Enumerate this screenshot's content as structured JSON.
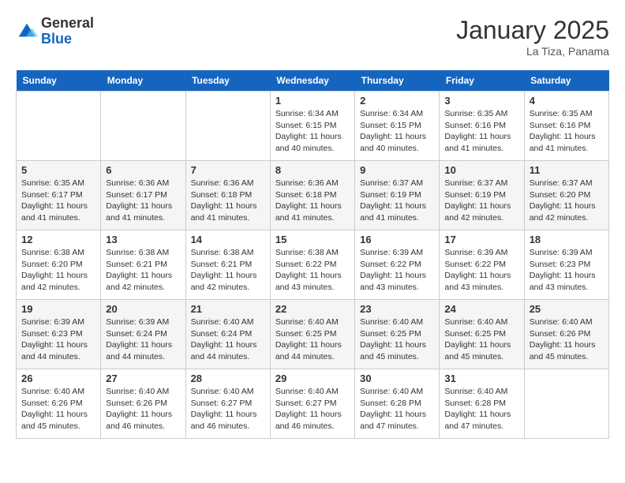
{
  "header": {
    "logo_general": "General",
    "logo_blue": "Blue",
    "month_year": "January 2025",
    "location": "La Tiza, Panama"
  },
  "days_of_week": [
    "Sunday",
    "Monday",
    "Tuesday",
    "Wednesday",
    "Thursday",
    "Friday",
    "Saturday"
  ],
  "weeks": [
    [
      {
        "num": "",
        "sunrise": "",
        "sunset": "",
        "daylight": "",
        "empty": true
      },
      {
        "num": "",
        "sunrise": "",
        "sunset": "",
        "daylight": "",
        "empty": true
      },
      {
        "num": "",
        "sunrise": "",
        "sunset": "",
        "daylight": "",
        "empty": true
      },
      {
        "num": "1",
        "sunrise": "Sunrise: 6:34 AM",
        "sunset": "Sunset: 6:15 PM",
        "daylight": "Daylight: 11 hours and 40 minutes."
      },
      {
        "num": "2",
        "sunrise": "Sunrise: 6:34 AM",
        "sunset": "Sunset: 6:15 PM",
        "daylight": "Daylight: 11 hours and 40 minutes."
      },
      {
        "num": "3",
        "sunrise": "Sunrise: 6:35 AM",
        "sunset": "Sunset: 6:16 PM",
        "daylight": "Daylight: 11 hours and 41 minutes."
      },
      {
        "num": "4",
        "sunrise": "Sunrise: 6:35 AM",
        "sunset": "Sunset: 6:16 PM",
        "daylight": "Daylight: 11 hours and 41 minutes."
      }
    ],
    [
      {
        "num": "5",
        "sunrise": "Sunrise: 6:35 AM",
        "sunset": "Sunset: 6:17 PM",
        "daylight": "Daylight: 11 hours and 41 minutes."
      },
      {
        "num": "6",
        "sunrise": "Sunrise: 6:36 AM",
        "sunset": "Sunset: 6:17 PM",
        "daylight": "Daylight: 11 hours and 41 minutes."
      },
      {
        "num": "7",
        "sunrise": "Sunrise: 6:36 AM",
        "sunset": "Sunset: 6:18 PM",
        "daylight": "Daylight: 11 hours and 41 minutes."
      },
      {
        "num": "8",
        "sunrise": "Sunrise: 6:36 AM",
        "sunset": "Sunset: 6:18 PM",
        "daylight": "Daylight: 11 hours and 41 minutes."
      },
      {
        "num": "9",
        "sunrise": "Sunrise: 6:37 AM",
        "sunset": "Sunset: 6:19 PM",
        "daylight": "Daylight: 11 hours and 41 minutes."
      },
      {
        "num": "10",
        "sunrise": "Sunrise: 6:37 AM",
        "sunset": "Sunset: 6:19 PM",
        "daylight": "Daylight: 11 hours and 42 minutes."
      },
      {
        "num": "11",
        "sunrise": "Sunrise: 6:37 AM",
        "sunset": "Sunset: 6:20 PM",
        "daylight": "Daylight: 11 hours and 42 minutes."
      }
    ],
    [
      {
        "num": "12",
        "sunrise": "Sunrise: 6:38 AM",
        "sunset": "Sunset: 6:20 PM",
        "daylight": "Daylight: 11 hours and 42 minutes."
      },
      {
        "num": "13",
        "sunrise": "Sunrise: 6:38 AM",
        "sunset": "Sunset: 6:21 PM",
        "daylight": "Daylight: 11 hours and 42 minutes."
      },
      {
        "num": "14",
        "sunrise": "Sunrise: 6:38 AM",
        "sunset": "Sunset: 6:21 PM",
        "daylight": "Daylight: 11 hours and 42 minutes."
      },
      {
        "num": "15",
        "sunrise": "Sunrise: 6:38 AM",
        "sunset": "Sunset: 6:22 PM",
        "daylight": "Daylight: 11 hours and 43 minutes."
      },
      {
        "num": "16",
        "sunrise": "Sunrise: 6:39 AM",
        "sunset": "Sunset: 6:22 PM",
        "daylight": "Daylight: 11 hours and 43 minutes."
      },
      {
        "num": "17",
        "sunrise": "Sunrise: 6:39 AM",
        "sunset": "Sunset: 6:22 PM",
        "daylight": "Daylight: 11 hours and 43 minutes."
      },
      {
        "num": "18",
        "sunrise": "Sunrise: 6:39 AM",
        "sunset": "Sunset: 6:23 PM",
        "daylight": "Daylight: 11 hours and 43 minutes."
      }
    ],
    [
      {
        "num": "19",
        "sunrise": "Sunrise: 6:39 AM",
        "sunset": "Sunset: 6:23 PM",
        "daylight": "Daylight: 11 hours and 44 minutes."
      },
      {
        "num": "20",
        "sunrise": "Sunrise: 6:39 AM",
        "sunset": "Sunset: 6:24 PM",
        "daylight": "Daylight: 11 hours and 44 minutes."
      },
      {
        "num": "21",
        "sunrise": "Sunrise: 6:40 AM",
        "sunset": "Sunset: 6:24 PM",
        "daylight": "Daylight: 11 hours and 44 minutes."
      },
      {
        "num": "22",
        "sunrise": "Sunrise: 6:40 AM",
        "sunset": "Sunset: 6:25 PM",
        "daylight": "Daylight: 11 hours and 44 minutes."
      },
      {
        "num": "23",
        "sunrise": "Sunrise: 6:40 AM",
        "sunset": "Sunset: 6:25 PM",
        "daylight": "Daylight: 11 hours and 45 minutes."
      },
      {
        "num": "24",
        "sunrise": "Sunrise: 6:40 AM",
        "sunset": "Sunset: 6:25 PM",
        "daylight": "Daylight: 11 hours and 45 minutes."
      },
      {
        "num": "25",
        "sunrise": "Sunrise: 6:40 AM",
        "sunset": "Sunset: 6:26 PM",
        "daylight": "Daylight: 11 hours and 45 minutes."
      }
    ],
    [
      {
        "num": "26",
        "sunrise": "Sunrise: 6:40 AM",
        "sunset": "Sunset: 6:26 PM",
        "daylight": "Daylight: 11 hours and 45 minutes."
      },
      {
        "num": "27",
        "sunrise": "Sunrise: 6:40 AM",
        "sunset": "Sunset: 6:26 PM",
        "daylight": "Daylight: 11 hours and 46 minutes."
      },
      {
        "num": "28",
        "sunrise": "Sunrise: 6:40 AM",
        "sunset": "Sunset: 6:27 PM",
        "daylight": "Daylight: 11 hours and 46 minutes."
      },
      {
        "num": "29",
        "sunrise": "Sunrise: 6:40 AM",
        "sunset": "Sunset: 6:27 PM",
        "daylight": "Daylight: 11 hours and 46 minutes."
      },
      {
        "num": "30",
        "sunrise": "Sunrise: 6:40 AM",
        "sunset": "Sunset: 6:28 PM",
        "daylight": "Daylight: 11 hours and 47 minutes."
      },
      {
        "num": "31",
        "sunrise": "Sunrise: 6:40 AM",
        "sunset": "Sunset: 6:28 PM",
        "daylight": "Daylight: 11 hours and 47 minutes."
      },
      {
        "num": "",
        "sunrise": "",
        "sunset": "",
        "daylight": "",
        "empty": true
      }
    ]
  ]
}
